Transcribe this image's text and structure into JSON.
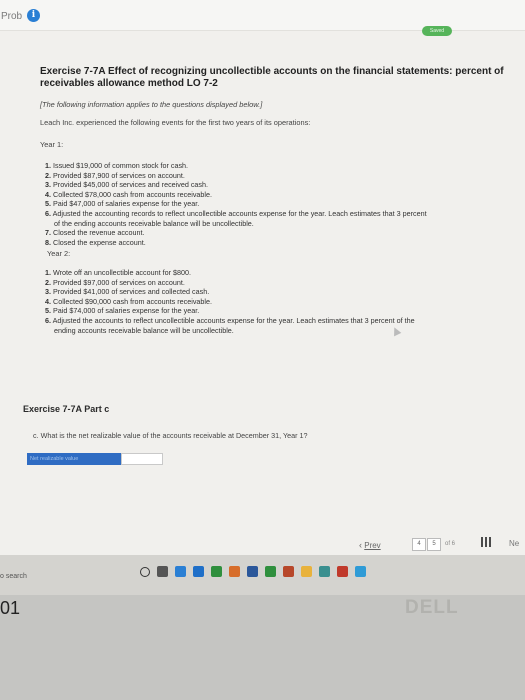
{
  "header": {
    "prob_label": "Prob",
    "info_glyph": "i",
    "saved_label": "Saved"
  },
  "exercise": {
    "title": "Exercise 7-7A Effect of recognizing uncollectible accounts on the financial statements: percent of receivables allowance method LO 7-2",
    "intro": "[The following information applies to the questions displayed below.]",
    "lead": "Leach Inc. experienced the following events for the first two years of its operations:",
    "year1": {
      "label": "Year 1:",
      "events": [
        {
          "num": "1.",
          "text": "Issued $19,000 of common stock for cash."
        },
        {
          "num": "2.",
          "text": "Provided $87,900 of services on account."
        },
        {
          "num": "3.",
          "text": "Provided $45,000 of services and received cash."
        },
        {
          "num": "4.",
          "text": "Collected $78,000 cash from accounts receivable."
        },
        {
          "num": "5.",
          "text": "Paid $47,000 of salaries expense for the year."
        },
        {
          "num": "6.",
          "text": "Adjusted the accounting records to reflect uncollectible accounts expense for the year. Leach estimates that 3 percent",
          "cont": "of the ending accounts receivable balance will be uncollectible."
        },
        {
          "num": "7.",
          "text": "Closed the revenue account."
        },
        {
          "num": "8.",
          "text": "Closed the expense account."
        }
      ]
    },
    "year2": {
      "label": "Year 2:",
      "events": [
        {
          "num": "1.",
          "text": "Wrote off an uncollectible account for $800."
        },
        {
          "num": "2.",
          "text": "Provided $97,000 of services on account."
        },
        {
          "num": "3.",
          "text": "Provided $41,000 of services and collected cash."
        },
        {
          "num": "4.",
          "text": "Collected $90,000 cash from accounts receivable."
        },
        {
          "num": "5.",
          "text": "Paid $74,000 of salaries expense for the year."
        },
        {
          "num": "6.",
          "text": "Adjusted the accounts to reflect uncollectible accounts expense for the year. Leach estimates that 3 percent of the",
          "cont": "ending accounts receivable balance will be uncollectible."
        }
      ]
    }
  },
  "part": {
    "title": "Exercise 7-7A Part c",
    "question": "c. What is the net realizable value of the accounts receivable at December 31, Year 1?",
    "answer_label": "Net realizable value",
    "answer_value": ""
  },
  "nav": {
    "prev_chevron": "‹",
    "prev_label": "Prev",
    "pages": [
      "4",
      "5"
    ],
    "of_text": "of 6",
    "next_label": "Ne"
  },
  "taskbar": {
    "search_text": "o search"
  },
  "device": {
    "brand": "DELL",
    "corner_number": "01"
  },
  "colors": {
    "accent": "#2f6cc3",
    "saved_green": "#56b45a",
    "info_blue": "#2a7fd4"
  }
}
